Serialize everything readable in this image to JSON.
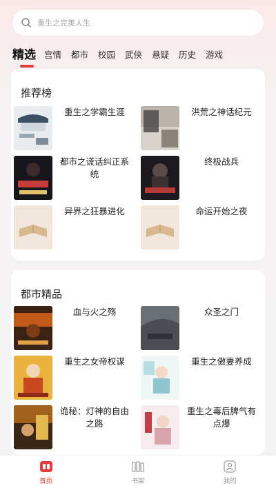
{
  "search": {
    "placeholder": "重生之完美人生",
    "icon": "search-icon"
  },
  "tabs": [
    {
      "label": "精选",
      "active": true
    },
    {
      "label": "宫情"
    },
    {
      "label": "都市"
    },
    {
      "label": "校园"
    },
    {
      "label": "武侠"
    },
    {
      "label": "悬疑"
    },
    {
      "label": "历史"
    },
    {
      "label": "游戏"
    }
  ],
  "recommend": {
    "title": "推荐榜",
    "books": [
      {
        "title": "重生之学霸生涯"
      },
      {
        "title": "洪荒之神话纪元"
      },
      {
        "title": "都市之谎话纠正系统"
      },
      {
        "title": "终极战兵"
      },
      {
        "title": "异界之狂暴进化"
      },
      {
        "title": "命运开始之夜"
      }
    ]
  },
  "urban": {
    "title": "都市精品",
    "books": [
      {
        "title": "血与火之殇"
      },
      {
        "title": "众圣之门"
      },
      {
        "title": "重生之女帝权谋"
      },
      {
        "title": "重生之傲妻养成"
      },
      {
        "title": "诡秘：灯神的自由之路"
      },
      {
        "title": "重生之毒后脾气有点爆"
      }
    ]
  },
  "bottom_nav": [
    {
      "label": "首页",
      "icon": "home-icon",
      "active": true
    },
    {
      "label": "书架",
      "icon": "bookshelf-icon"
    },
    {
      "label": "我的",
      "icon": "profile-icon"
    }
  ],
  "colors": {
    "accent": "#e8393a",
    "inactive": "#9a9a9a",
    "background": "#f3f3f3",
    "card": "#ffffff"
  }
}
